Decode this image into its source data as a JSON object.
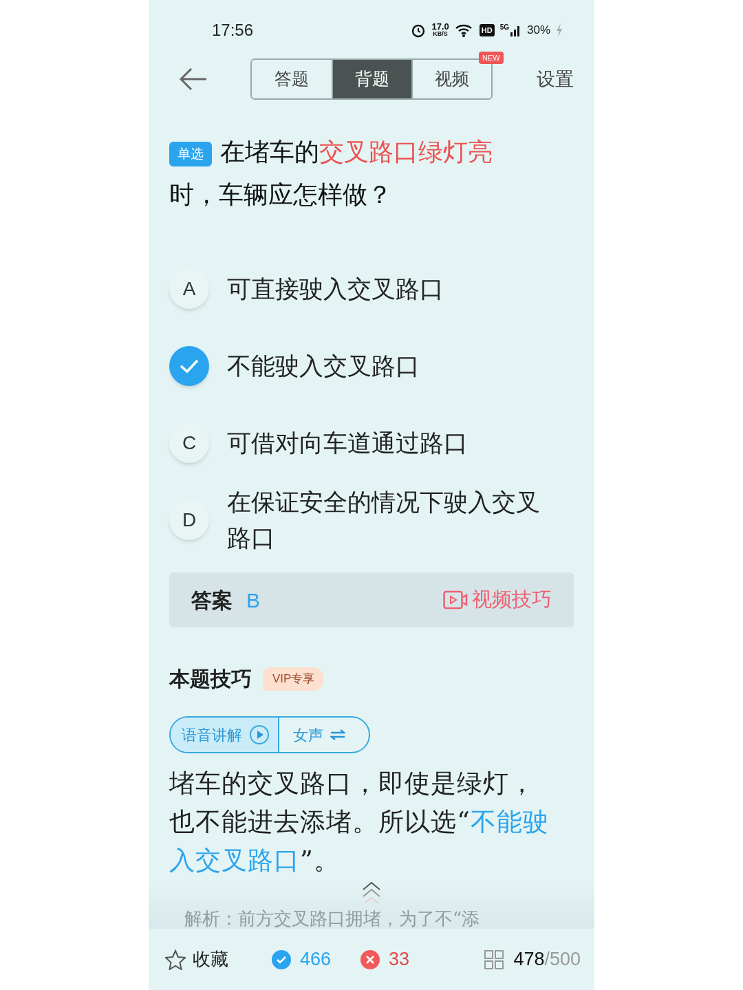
{
  "status_bar": {
    "time": "17:56",
    "speed": "17.0",
    "speed_unit": "KB/S",
    "hd": "HD",
    "network": "5G",
    "battery": "30%"
  },
  "nav": {
    "tabs": [
      {
        "label": "答题",
        "selected": false
      },
      {
        "label": "背题",
        "selected": true
      },
      {
        "label": "视频",
        "selected": false,
        "badge": "NEW"
      }
    ],
    "settings": "设置"
  },
  "question": {
    "type_badge": "单选",
    "parts": [
      {
        "text": "在堵车的",
        "highlight": false
      },
      {
        "text": "交叉路口绿灯亮",
        "highlight": true
      },
      {
        "text": "时，车辆应怎样做？",
        "highlight": false
      }
    ]
  },
  "options": [
    {
      "letter": "A",
      "text": "可直接驶入交叉路口",
      "selected": false
    },
    {
      "text": "不能驶入交叉路口",
      "selected": true
    },
    {
      "letter": "C",
      "text": "可借对向车道通过路口",
      "selected": false
    },
    {
      "letter": "D",
      "text": "在保证安全的情况下驶入交叉路口",
      "selected": false
    }
  ],
  "answer": {
    "label": "答案",
    "value": "B",
    "video_link": "视频技巧"
  },
  "tips": {
    "title": "本题技巧",
    "badge": "VIP专享",
    "voice_button": "语音讲解",
    "voice_toggle": "女声"
  },
  "explanation": [
    {
      "text": "堵车的交叉路口，即使是绿灯，也不能进去添堵。所以选“",
      "highlight": false
    },
    {
      "text": "不能驶入交叉路口",
      "highlight": true
    },
    {
      "text": "”。",
      "highlight": false
    }
  ],
  "analysis_preview": "解析：前方交叉路口拥堵，为了不“添",
  "bottom_bar": {
    "favorite": "收藏",
    "correct": "466",
    "wrong": "33",
    "progress_current": "478",
    "progress_total": "/500"
  }
}
